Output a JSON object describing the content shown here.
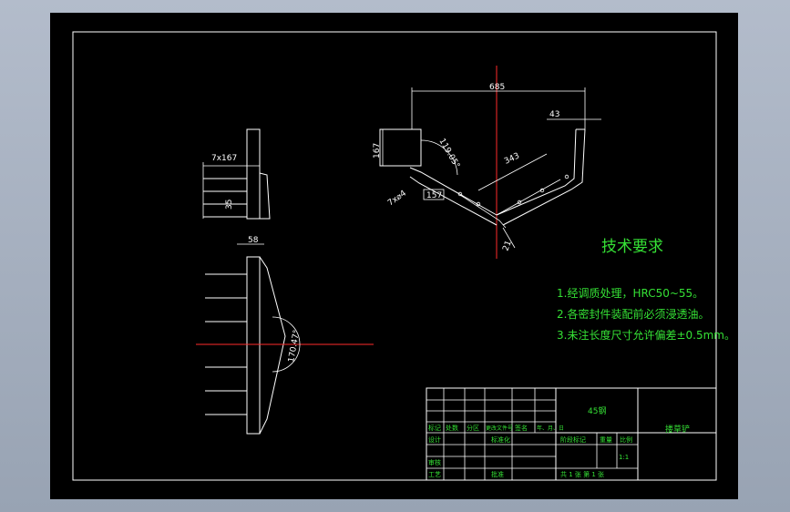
{
  "dimensions": {
    "overall_width": "685",
    "top_offset": "43",
    "left_height": "167",
    "arm_length": "343",
    "angle_top": "119.05°",
    "small_left": "7x⌀4",
    "small_len": "157",
    "tip": "21",
    "side_hole": "7x167",
    "side_width": "35",
    "bottom_width": "58",
    "bottom_angle": "170.47°"
  },
  "requirements": {
    "title": "技术要求",
    "items": [
      "1.经调质处理，HRC50~55。",
      "2.各密封件装配前必须浸透油。",
      "3.未注长度尺寸允许偏差±0.5mm。"
    ]
  },
  "title_block": {
    "material": "45钢",
    "part_name": "搂草铲",
    "row_labels": [
      "标记",
      "处数",
      "分区",
      "更改文件号",
      "签名",
      "年、月、日"
    ],
    "design": "设计",
    "standard": "标准化",
    "stage_label": "阶段标记",
    "weight_label": "重量",
    "scale_label": "比例",
    "scale_value": "1:1",
    "review": "审核",
    "process": "工艺",
    "approve": "批准",
    "sheet_info": "共 1 张   第 1 张"
  }
}
